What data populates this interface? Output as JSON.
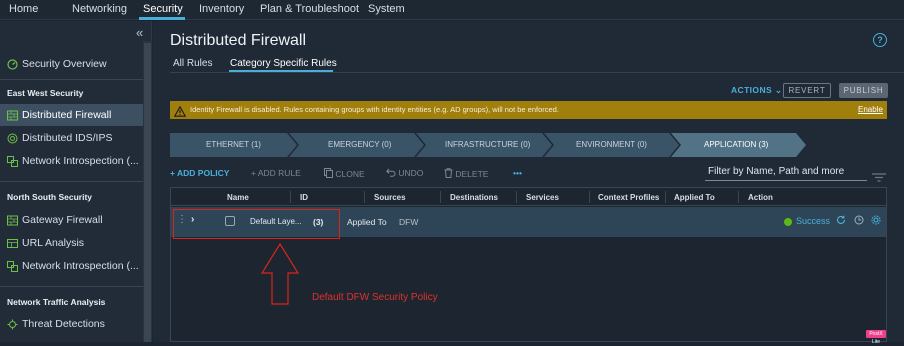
{
  "topnav": {
    "items": [
      "Home",
      "Networking",
      "Security",
      "Inventory",
      "Plan & Troubleshoot",
      "System"
    ]
  },
  "sidebar": {
    "collapse_glyph": "«",
    "overview": "Security Overview",
    "sections": [
      {
        "title": "East West Security",
        "items": [
          "Distributed Firewall",
          "Distributed IDS/IPS",
          "Network Introspection (..."
        ]
      },
      {
        "title": "North South Security",
        "items": [
          "Gateway Firewall",
          "URL Analysis",
          "Network Introspection (..."
        ]
      },
      {
        "title": "Network Traffic Analysis",
        "items": [
          "Threat Detections"
        ]
      }
    ]
  },
  "main": {
    "title": "Distributed Firewall",
    "help_glyph": "?",
    "tabs": [
      "All Rules",
      "Category Specific Rules"
    ],
    "actions_label": "ACTIONS",
    "revert_label": "REVERT",
    "publish_label": "PUBLISH",
    "alert": {
      "message": "Identity Firewall is disabled. Rules containing groups with identity entities (e.g. AD groups), will not be enforced.",
      "link": "Enable"
    },
    "categories": [
      "ETHERNET (1)",
      "EMERGENCY (0)",
      "INFRASTRUCTURE (0)",
      "ENVIRONMENT (0)",
      "APPLICATION (3)"
    ],
    "toolbar": {
      "add_policy": "+ ADD POLICY",
      "add_rule": "+ ADD RULE",
      "clone": "CLONE",
      "undo": "UNDO",
      "delete": "DELETE",
      "more": "•••"
    },
    "filter_placeholder": "Filter by Name, Path and more",
    "table": {
      "headers": [
        "Name",
        "ID",
        "Sources",
        "Destinations",
        "Services",
        "Context Profiles",
        "Applied To",
        "Action"
      ],
      "row": {
        "name": "Default Laye...",
        "count": "(3)",
        "applied_to_label": "Applied To",
        "applied_to_value": "DFW",
        "status": "Success"
      }
    }
  },
  "annotation": {
    "text": "Default DFW Security Policy"
  },
  "badge_text": "PostX Lite",
  "colors": {
    "accent": "#49afd9",
    "warning": "#a07f0d",
    "success": "#5eb715",
    "annotation": "#e0322a"
  }
}
